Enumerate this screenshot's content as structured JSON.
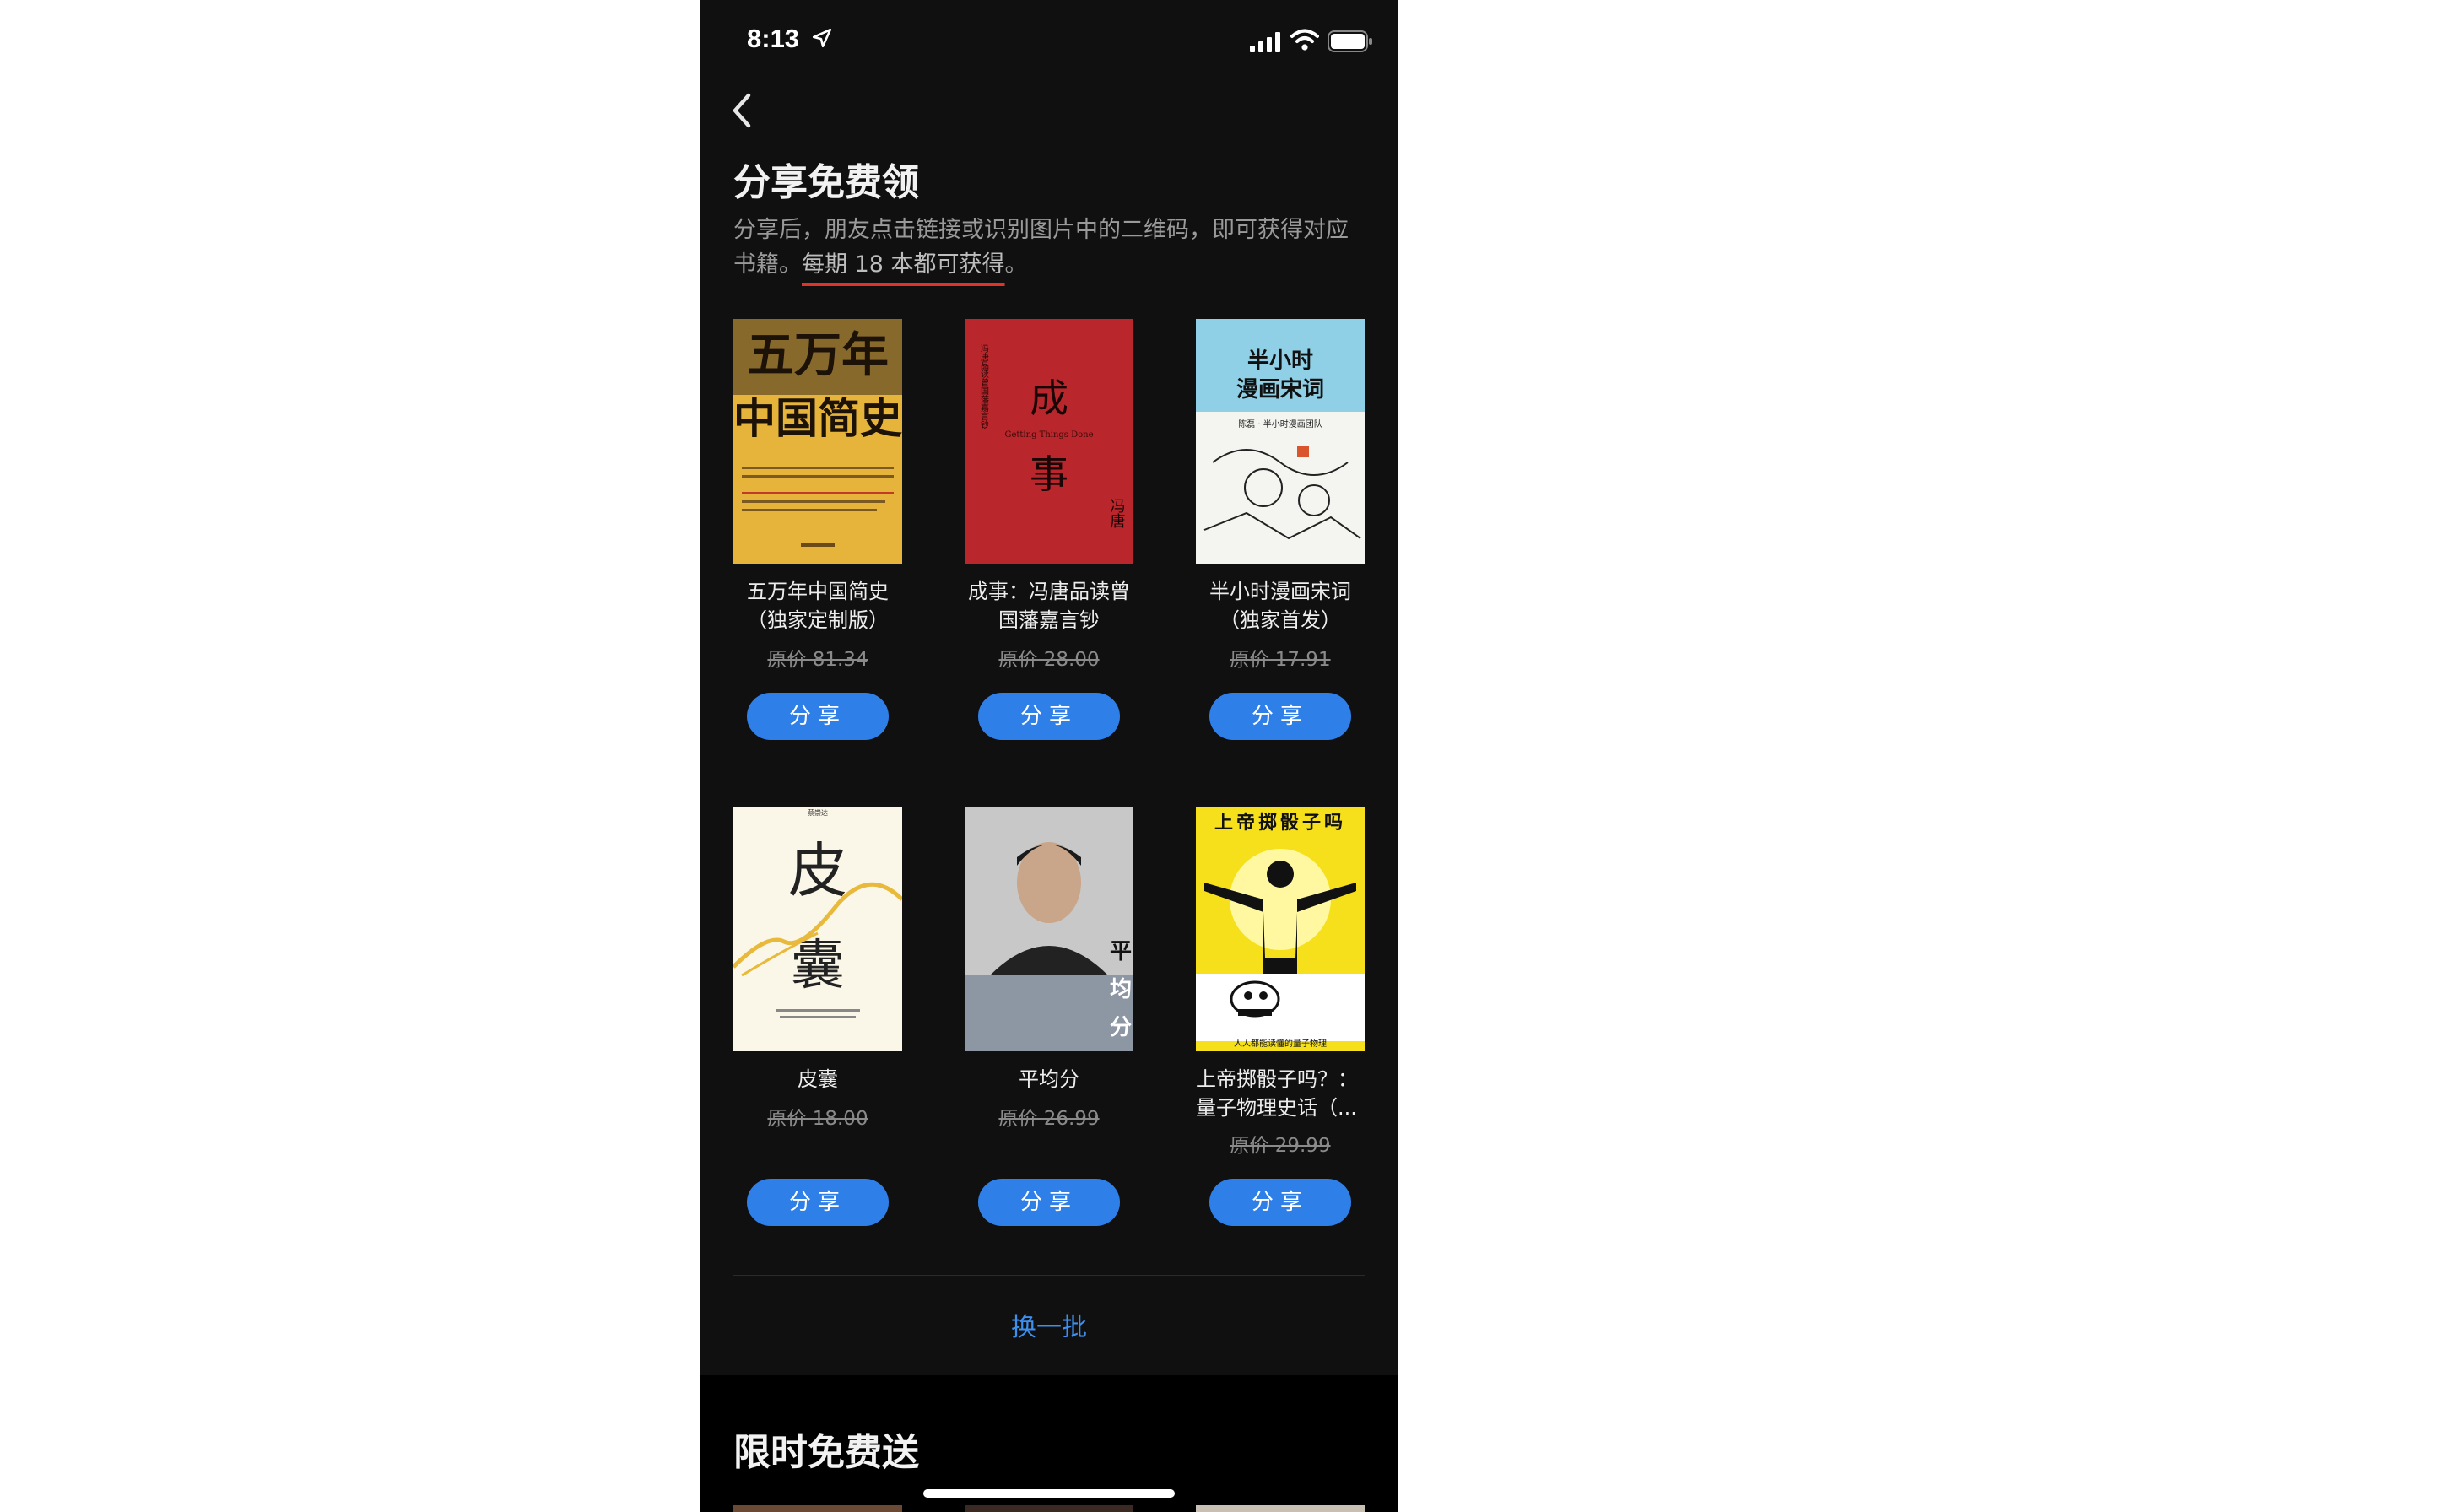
{
  "status_bar": {
    "time": "8:13"
  },
  "header": {
    "back_icon": "chevron-left-icon"
  },
  "section": {
    "title": "分享免费领",
    "description_prefix": "分享后，朋友点击链接或识别图片中的二维码，即可获得对应书籍。",
    "description_highlight": "每期 18 本都可获得",
    "description_suffix": "。"
  },
  "books": [
    {
      "title": "五万年中国简史（独家定制版）",
      "price": "原价 81.34",
      "share": "分享",
      "cover_lines": [
        "五万年",
        "中国简史"
      ]
    },
    {
      "title": "成事：冯唐品读曾国藩嘉言钞",
      "price": "原价 28.00",
      "share": "分享",
      "cover_lines": [
        "成",
        "事",
        "Getting Things Done",
        "冯唐",
        "冯唐品读曾国藩嘉言钞"
      ]
    },
    {
      "title": "半小时漫画宋词（独家首发）",
      "price": "原价 17.91",
      "share": "分享",
      "cover_lines": [
        "半小时",
        "漫画宋词",
        "陈磊 · 半小时漫画团队"
      ]
    },
    {
      "title": "皮囊",
      "price": "原价 18.00",
      "share": "分享",
      "cover_lines": [
        "蔡崇达",
        "皮",
        "囊"
      ]
    },
    {
      "title": "平均分",
      "price": "原价 26.99",
      "share": "分享",
      "cover_lines": [
        "平",
        "均",
        "分"
      ]
    },
    {
      "title": "上帝掷骰子吗？：量子物理史话（...",
      "price": "原价 29.99",
      "share": "分享",
      "cover_lines": [
        "上帝掷骰子吗",
        "人人都能读懂的量子物理"
      ]
    }
  ],
  "refresh_label": "换一批",
  "next_section": {
    "title": "限时免费送"
  },
  "colors": {
    "accent": "#2f7fe8",
    "link": "#3d8ff0",
    "underline": "#e0342a"
  }
}
